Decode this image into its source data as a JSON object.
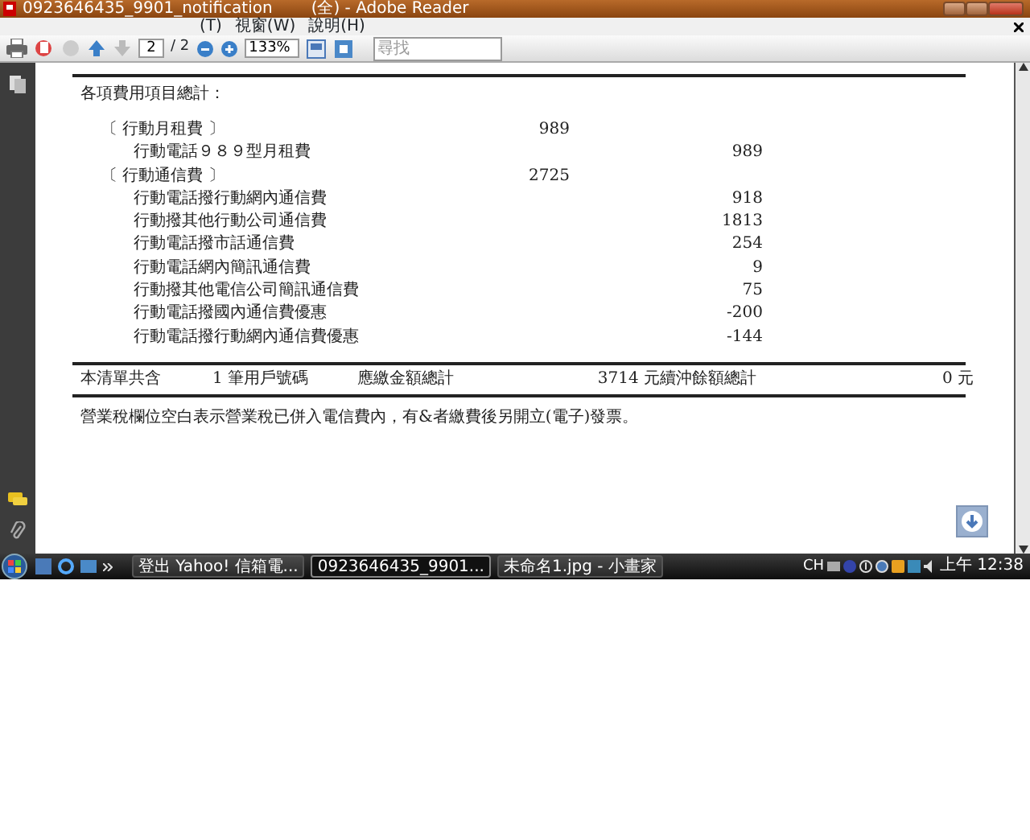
{
  "window": {
    "title_parts": [
      "0923646435_9901_notification",
      "(全) - Adobe Reader"
    ]
  },
  "menu": [
    "(T)",
    "視窗(W)",
    "說明(H)"
  ],
  "toolbar": {
    "page": "2",
    "page_total": "/ 2",
    "zoom": "133%",
    "search": {
      "placeholder": "尋找"
    }
  },
  "document": {
    "section_title": "各項費用項目總計：",
    "items": [
      {
        "kind": "group",
        "label": "〔 行動月租費 〕",
        "amount": "989"
      },
      {
        "kind": "item",
        "label": "行動電話９８９型月租費",
        "amount": "989"
      },
      {
        "kind": "group",
        "label": "〔 行動通信費 〕",
        "amount": "2725"
      },
      {
        "kind": "item",
        "label": "行動電話撥行動網內通信費",
        "amount": "918"
      },
      {
        "kind": "item",
        "label": "行動撥其他行動公司通信費",
        "amount": "1813"
      },
      {
        "kind": "item",
        "label": "行動電話撥市話通信費",
        "amount": "254"
      },
      {
        "kind": "item",
        "label": "行動電話網內簡訊通信費",
        "amount": "9"
      },
      {
        "kind": "item",
        "label": "行動撥其他電信公司簡訊通信費",
        "amount": "75"
      },
      {
        "kind": "item",
        "label": "行動電話撥國內通信費優惠",
        "amount": "-200"
      },
      {
        "kind": "item",
        "label": "行動電話撥行動網內通信費優惠",
        "amount": "-144"
      }
    ],
    "summary": [
      "本清單共含",
      "1 筆用戶號碼",
      "應繳金額總計",
      "3714 元",
      "續沖餘額總計",
      "0 元"
    ],
    "note": "營業稅欄位空白表示營業稅已併入電信費內，有&者繳費後另開立(電子)發票。"
  },
  "taskbar": {
    "tasks": [
      {
        "label": "登出 Yahoo! 信箱電...",
        "selected": false
      },
      {
        "label": "0923646435_9901...",
        "selected": true
      },
      {
        "label": "未命名1.jpg - 小畫家",
        "selected": false
      }
    ],
    "language": "CH",
    "clock": "上午 12:38"
  }
}
